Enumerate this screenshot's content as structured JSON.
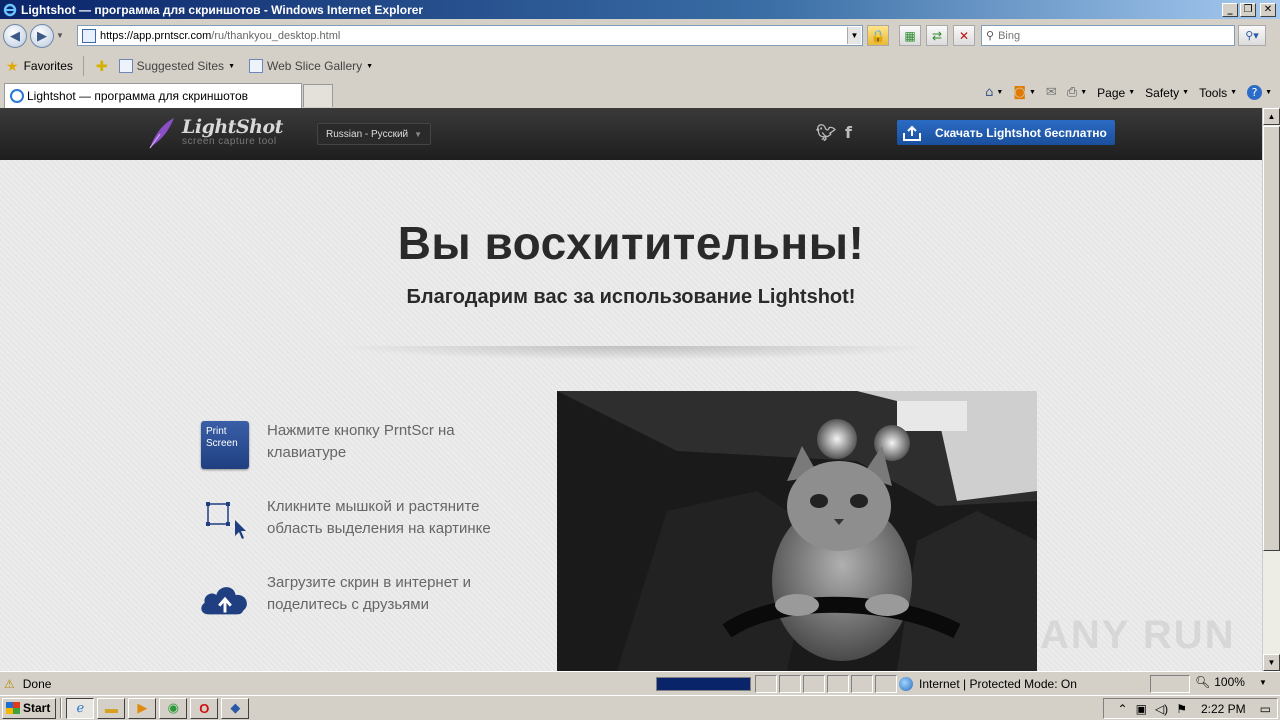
{
  "window": {
    "title": "Lightshot — программа для скриншотов - Windows Internet Explorer",
    "minimize": "_",
    "maximize": "❐",
    "close": "✕"
  },
  "navigation": {
    "back": "◀",
    "forward": "▶",
    "url_host": "https://app.prntscr.com",
    "url_path": "/ru/thankyou_desktop.html",
    "search_placeholder": "Bing"
  },
  "favorites_bar": {
    "favorites_label": "Favorites",
    "suggested_sites": "Suggested Sites",
    "web_slice_gallery": "Web Slice Gallery"
  },
  "tabs": [
    {
      "label": "Lightshot — программа для скриншотов"
    }
  ],
  "command_bar": {
    "page": "Page",
    "safety": "Safety",
    "tools": "Tools"
  },
  "site": {
    "brand_name": "LightShot",
    "brand_tagline": "screen capture tool",
    "language": "Russian - Русский",
    "download_button": "Скачать Lightshot бесплатно",
    "headline": "Вы восхитительны!",
    "subheadline": "Благодарим вас за использование Lightshot!",
    "key_label_line1": "Print",
    "key_label_line2": "Screen",
    "steps": [
      {
        "text": "Нажмите кнопку PrntScr на клавиатуре",
        "icon": "print-screen-key-icon"
      },
      {
        "text": "Кликните мышкой и растяните область выделения на картинке",
        "icon": "selection-area-icon"
      },
      {
        "text": "Загрузите скрин в интернет и поделитесь с друзьями",
        "icon": "cloud-upload-icon"
      }
    ],
    "watermark": "ANY RUN"
  },
  "status_bar": {
    "status": "Done",
    "progress_fraction": 1.0,
    "zone": "Internet | Protected Mode: On",
    "zoom": "100%"
  },
  "taskbar": {
    "start": "Start",
    "clock": "2:22 PM"
  },
  "colors": {
    "accent_blue": "#1a4f9c",
    "header_dark": "#262626",
    "xp_titlebar": "#0a246a"
  }
}
